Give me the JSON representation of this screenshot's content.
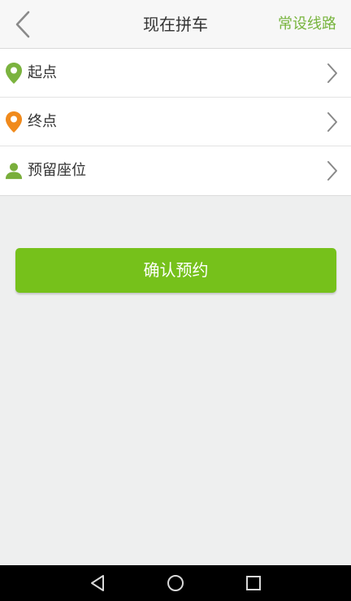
{
  "header": {
    "title": "现在拼车",
    "right_link": "常设线路",
    "back_icon": "chevron-left-icon"
  },
  "form": {
    "rows": [
      {
        "label": "起点",
        "icon": "location-pin-icon",
        "icon_color": "#7bb33f"
      },
      {
        "label": "终点",
        "icon": "location-pin-icon",
        "icon_color": "#f08a1c"
      },
      {
        "label": "预留座位",
        "icon": "person-icon",
        "icon_color": "#79ae3b"
      }
    ]
  },
  "confirm": {
    "label": "确认预约",
    "color": "#76c11b"
  },
  "navbar": {
    "buttons": [
      "back-triangle-icon",
      "home-circle-icon",
      "recent-square-icon"
    ]
  },
  "colors": {
    "accent": "#77b43d",
    "background": "#eeefef"
  }
}
